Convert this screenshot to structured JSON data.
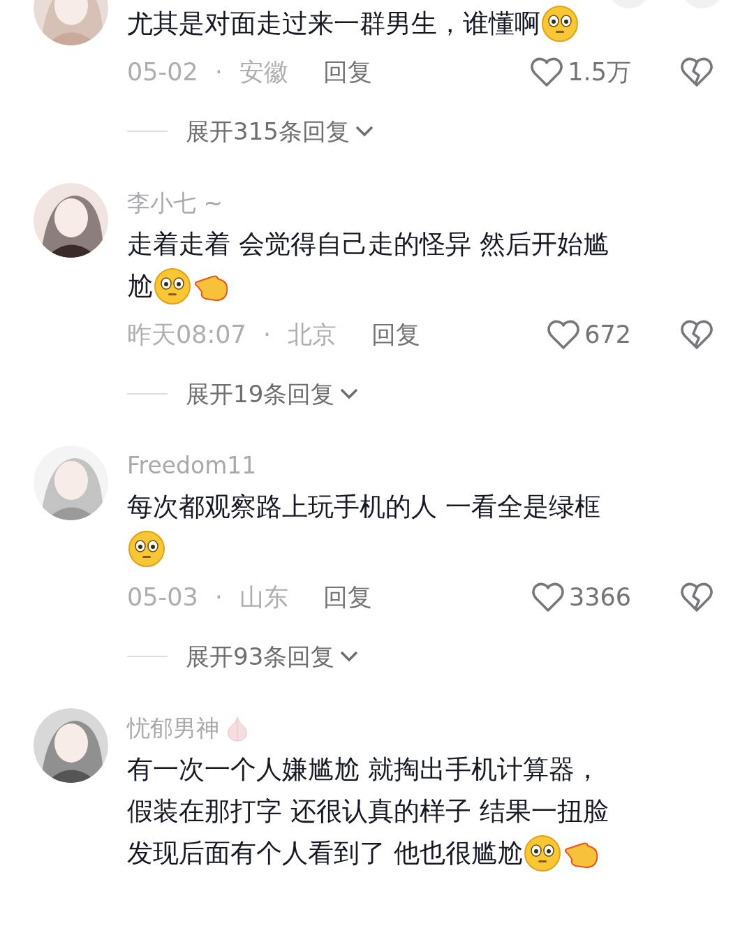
{
  "comments": [
    {
      "cut_top": true,
      "lines": [
        "尤其是对面走过来一群男生，谁懂啊"
      ],
      "emojis": [
        {
          "kind": "face"
        }
      ],
      "date": "05-02",
      "separator": "·",
      "location": "安徽",
      "reply": "回复",
      "likes": "1.5万",
      "expand": "展开315条回复"
    },
    {
      "username": "李小七 ~",
      "lines": [
        "走着走着 会觉得自己走的怪异 然后开始尴",
        "尬"
      ],
      "emojis": [
        {
          "kind": "face"
        },
        {
          "kind": "hand"
        }
      ],
      "date": "昨天08:07",
      "separator": "·",
      "location": "北京",
      "reply": "回复",
      "likes": "672",
      "expand": "展开19条回复"
    },
    {
      "username": "Freedom11",
      "lines": [
        "每次都观察路上玩手机的人 一看全是绿框"
      ],
      "emojis_own_line": true,
      "emojis": [
        {
          "kind": "face"
        }
      ],
      "date": "05-03",
      "separator": "·",
      "location": "山东",
      "reply": "回复",
      "likes": "3366",
      "expand": "展开93条回复"
    },
    {
      "username": "忧郁男神",
      "name_badge": true,
      "lines": [
        "有一次一个人嫌尴尬 就掏出手机计算器，",
        "假装在那打字 还很认真的样子 结果一扭脸",
        "发现后面有个人看到了 他也很尴尬"
      ],
      "emojis": [
        {
          "kind": "face"
        },
        {
          "kind": "hand"
        }
      ]
    }
  ]
}
